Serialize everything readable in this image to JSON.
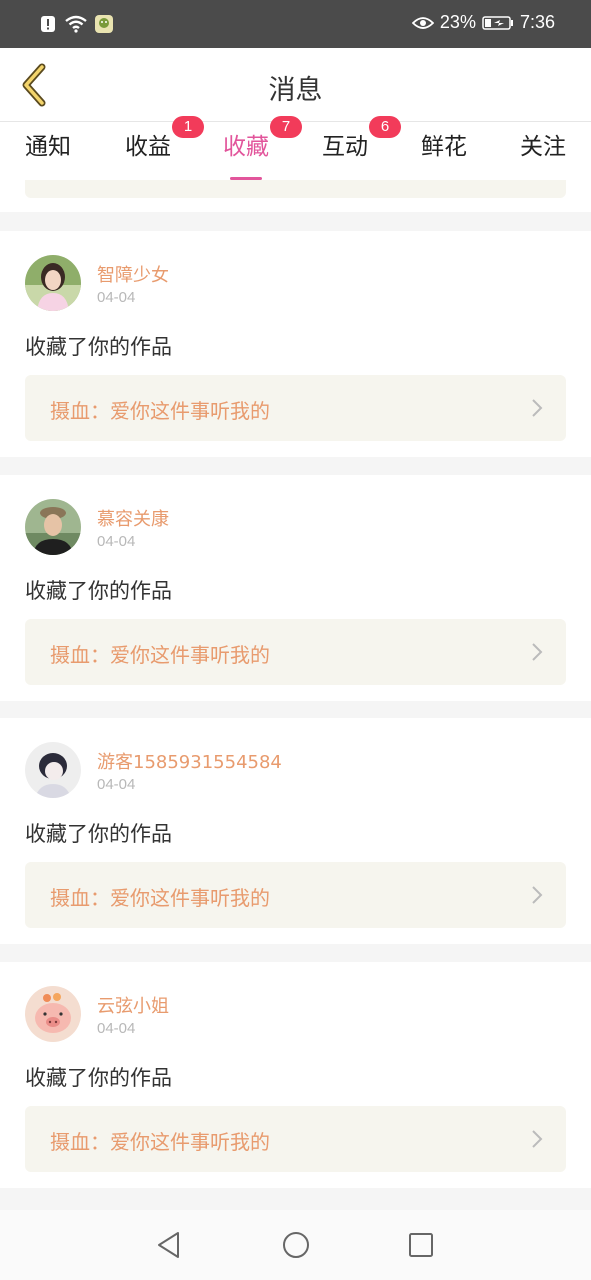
{
  "status_bar": {
    "battery_percent": "23%",
    "time": "7:36",
    "icons": [
      "alert-icon",
      "wifi-icon",
      "app-notification-icon",
      "eye-icon",
      "battery-icon"
    ]
  },
  "header": {
    "title": "消息",
    "back_icon": "chevron-left-icon"
  },
  "tabs": [
    {
      "label": "通知",
      "badge": null,
      "active": false
    },
    {
      "label": "收益",
      "badge": "1",
      "active": false
    },
    {
      "label": "收藏",
      "badge": "7",
      "active": true
    },
    {
      "label": "互动",
      "badge": "6",
      "active": false
    },
    {
      "label": "鲜花",
      "badge": null,
      "active": false
    },
    {
      "label": "关注",
      "badge": null,
      "active": false
    }
  ],
  "notifications": [
    {
      "user": "智障少女",
      "date": "04-04",
      "action": "收藏了你的作品",
      "work": "摄血：爱你这件事听我的"
    },
    {
      "user": "慕容关康",
      "date": "04-04",
      "action": "收藏了你的作品",
      "work": "摄血：爱你这件事听我的"
    },
    {
      "user": "游客1585931554584",
      "date": "04-04",
      "action": "收藏了你的作品",
      "work": "摄血：爱你这件事听我的"
    },
    {
      "user": "云弦小姐",
      "date": "04-04",
      "action": "收藏了你的作品",
      "work": "摄血：爱你这件事听我的"
    }
  ],
  "colors": {
    "accent": "#e2559b",
    "badge": "#f23b5a",
    "username": "#e89b6e",
    "work_bg": "#f6f5ee"
  },
  "nav_bar": [
    "back-triangle-icon",
    "home-circle-icon",
    "recents-square-icon"
  ]
}
